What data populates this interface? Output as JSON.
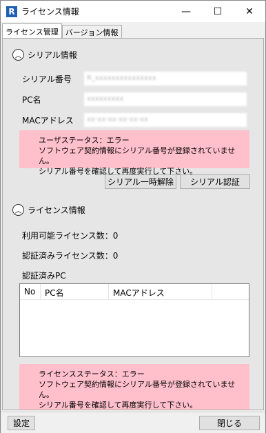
{
  "window": {
    "icon_letter": "R",
    "title": "ライセンス情報",
    "minimize": "—",
    "maximize": "☐",
    "close": "✕"
  },
  "tabs": [
    {
      "label": "ライセンス管理",
      "active": true
    },
    {
      "label": "バージョン情報",
      "active": false
    }
  ],
  "serial_section": {
    "header": "シリアル情報",
    "fields": [
      {
        "label": "シリアル番号",
        "value": "R_xxxxxxxxxxxxxxx"
      },
      {
        "label": "PC名",
        "value": "xxxxxxxxx"
      },
      {
        "label": "MACアドレス",
        "value": "xx-xx-xx-xx-xx-xx"
      }
    ],
    "error": {
      "line1": "ユーザステータス：エラー",
      "line2": "ソフトウェア契約情報にシリアル番号が登録されていません。",
      "line3": "シリアル番号を確認して再度実行して下さい。"
    },
    "buttons": {
      "release": "シリアル一時解除",
      "auth": "シリアル認証"
    }
  },
  "license_section": {
    "header": "ライセンス情報",
    "available_count": "利用可能ライセンス数：0",
    "authenticated_count": "認証済みライセンス数：0",
    "authenticated_pc_label": "認証済みPC",
    "table_columns": [
      "No",
      "PC名",
      "MACアドレス"
    ],
    "error": {
      "line1": "ライセンスステータス：エラー",
      "line2": "ソフトウェア契約情報にシリアル番号が登録されていません。",
      "line3": "シリアル番号を確認して再度実行して下さい。"
    }
  },
  "footer": {
    "settings": "設定",
    "close": "閉じる"
  }
}
